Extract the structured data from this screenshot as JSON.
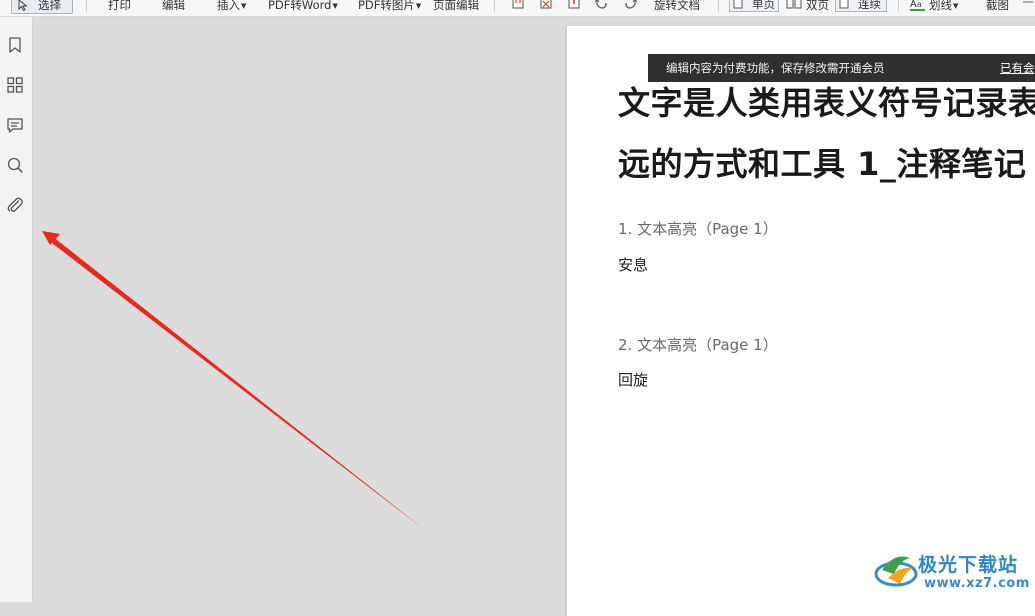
{
  "toolbar": {
    "select_label": "选择",
    "print_label": "打印",
    "edit_label": "编辑",
    "insert_label": "插入",
    "pdf_to_word_label": "PDF转Word",
    "pdf_to_image_label": "PDF转图片",
    "page_edit_label": "页面编辑",
    "rotate_doc_label": "旋转文档",
    "single_page_label": "单页",
    "double_page_label": "双页",
    "continuous_label": "连续",
    "strikethrough_label": "划线",
    "screenshot_label": "截图"
  },
  "sidebar": {
    "items": [
      {
        "icon": "bookmark-icon"
      },
      {
        "icon": "thumbnails-icon"
      },
      {
        "icon": "comment-icon"
      },
      {
        "icon": "search-icon"
      },
      {
        "icon": "attachment-icon"
      }
    ]
  },
  "notification": {
    "message": "编辑内容为付费功能，保存修改需开通会员",
    "link_label": "已有会"
  },
  "document": {
    "title_line1": "文字是人类用表义符号记录表",
    "title_line2": "远的方式和工具 1_注释笔记",
    "notes": [
      {
        "heading": "1. 文本高亮（Page 1）",
        "content": "安息"
      },
      {
        "heading": "2. 文本高亮（Page 1）",
        "content": "回旋"
      }
    ]
  },
  "watermark": {
    "title": "极光下载站",
    "url": "www.xz7.com"
  },
  "colors": {
    "arrow": "#e8291c",
    "notify_bg": "#2f2f2f",
    "watermark_blue": "#2f86c8"
  }
}
